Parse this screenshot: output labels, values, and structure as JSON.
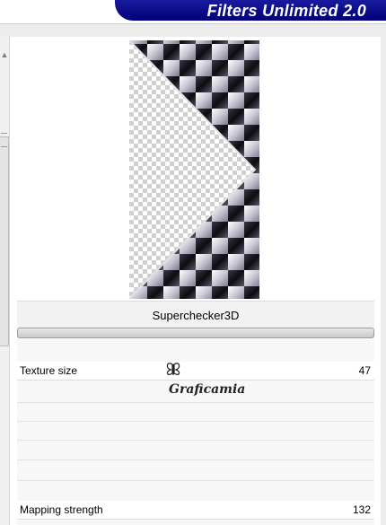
{
  "banner": {
    "title": "Filters Unlimited 2.0"
  },
  "filter": {
    "name": "Superchecker3D"
  },
  "params": [
    {
      "label": "Texture size",
      "value": "47"
    },
    {
      "label": "Mapping strength",
      "value": "132"
    }
  ],
  "watermark": {
    "text": "Graficamia"
  },
  "colors": {
    "banner": "#00007a",
    "checker_dark": "#1a1a1a",
    "checker_light": "#e8e8ee"
  }
}
